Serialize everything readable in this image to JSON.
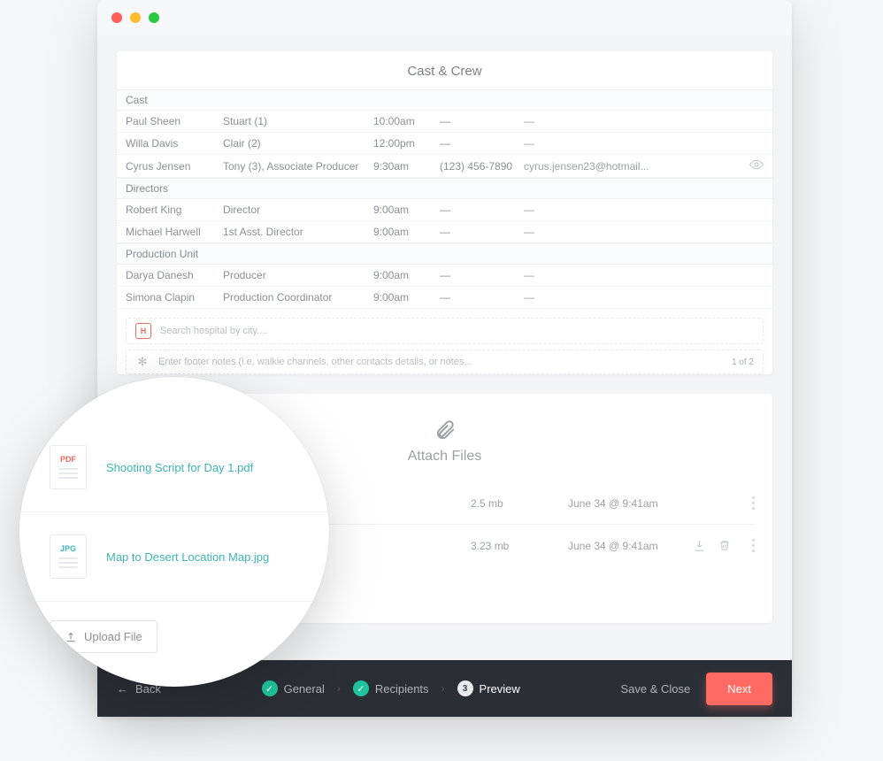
{
  "card_title": "Cast & Crew",
  "sections": {
    "cast": "Cast",
    "directors": "Directors",
    "production": "Production Unit"
  },
  "rows": {
    "cast": [
      {
        "name": "Paul Sheen",
        "role": "Stuart (1)",
        "time": "10:00am",
        "phone": "—",
        "email": "—"
      },
      {
        "name": "Willa Davis",
        "role": "Clair (2)",
        "time": "12:00pm",
        "phone": "—",
        "email": "—"
      },
      {
        "name": "Cyrus Jensen",
        "role": "Tony (3), Associate Producer",
        "time": "9:30am",
        "phone": "(123) 456-7890",
        "email": "cyrus.jensen23@hotmail..."
      }
    ],
    "directors": [
      {
        "name": "Robert King",
        "role": "Director",
        "time": "9:00am",
        "phone": "—",
        "email": "—"
      },
      {
        "name": "Michael Harwell",
        "role": "1st Asst. Director",
        "time": "9:00am",
        "phone": "—",
        "email": "—"
      }
    ],
    "production": [
      {
        "name": "Darya Danesh",
        "role": "Producer",
        "time": "9:00am",
        "phone": "—",
        "email": "—"
      },
      {
        "name": "Simona Clapin",
        "role": "Production Coordinator",
        "time": "9:00am",
        "phone": "—",
        "email": "—"
      }
    ]
  },
  "hospital_badge": "H",
  "hospital_ph": "Search hospital by city....",
  "footer_ph": "Enter footer notes (i.e. walkie channels, other contacts details, or notes...",
  "page_count": "1 of 2",
  "attach_title": "Attach Files",
  "files": [
    {
      "name": "Shooting Script for Day 1.pdf",
      "size": "2.5 mb",
      "date": "June 34 @ 9:41am",
      "type": "PDF",
      "tail": "r Day 1.pdf"
    },
    {
      "name": "Map to Desert Location Map.jpg",
      "size": "3.23 mb",
      "date": "June 34 @ 9:41am",
      "type": "JPG",
      "tail": "cation Map.jpg"
    }
  ],
  "upload_label": "Upload File",
  "nav": {
    "back": "Back",
    "general": "General",
    "recipients": "Recipients",
    "preview": "Preview",
    "preview_num": "3",
    "save": "Save & Close",
    "next": "Next"
  }
}
